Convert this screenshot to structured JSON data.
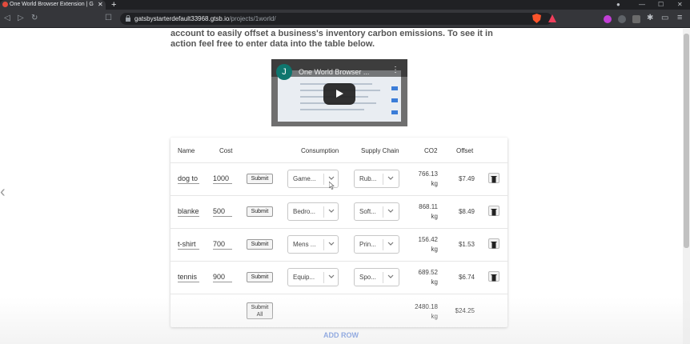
{
  "browser": {
    "tab_title": "One World Browser Extension | G",
    "url_host": "gatsbystarterdefault33968.gtsb.io",
    "url_path": "/projects/1world/"
  },
  "page": {
    "intro_text": "account to easily offset a business's inventory carbon emissions. To see it in action feel free to enter data into the table below.",
    "video": {
      "avatar_letter": "J",
      "title": "One World Browser ..."
    },
    "table": {
      "headers": {
        "name": "Name",
        "cost": "Cost",
        "consumption": "Consumption",
        "supply_chain": "Supply Chain",
        "co2": "CO2",
        "offset": "Offset"
      },
      "rows": [
        {
          "name": "dog to",
          "cost": "1000",
          "submit": "Submit",
          "consumption": "Game...",
          "supply_chain": "Rub...",
          "co2_value": "766.13",
          "co2_unit": "kg",
          "offset": "$7.49"
        },
        {
          "name": "blanke",
          "cost": "500",
          "submit": "Submit",
          "consumption": "Bedro...",
          "supply_chain": "Soft...",
          "co2_value": "868.11",
          "co2_unit": "kg",
          "offset": "$8.49"
        },
        {
          "name": "t-shirt",
          "cost": "700",
          "submit": "Submit",
          "consumption": "Mens ...",
          "supply_chain": "Prin...",
          "co2_value": "156.42",
          "co2_unit": "kg",
          "offset": "$1.53"
        },
        {
          "name": "tennis",
          "cost": "900",
          "submit": "Submit",
          "consumption": "Equip...",
          "supply_chain": "Spo...",
          "co2_value": "689.52",
          "co2_unit": "kg",
          "offset": "$6.74"
        }
      ],
      "total": {
        "submit_line1": "Submit",
        "submit_line2": "All",
        "co2_value": "2480.18",
        "co2_unit": "kg",
        "offset": "$24.25"
      },
      "add_row": "ADD ROW"
    }
  },
  "colors": {
    "accent": "#3f6ed6",
    "chrome_dark": "#202124",
    "chrome_mid": "#35363a"
  }
}
